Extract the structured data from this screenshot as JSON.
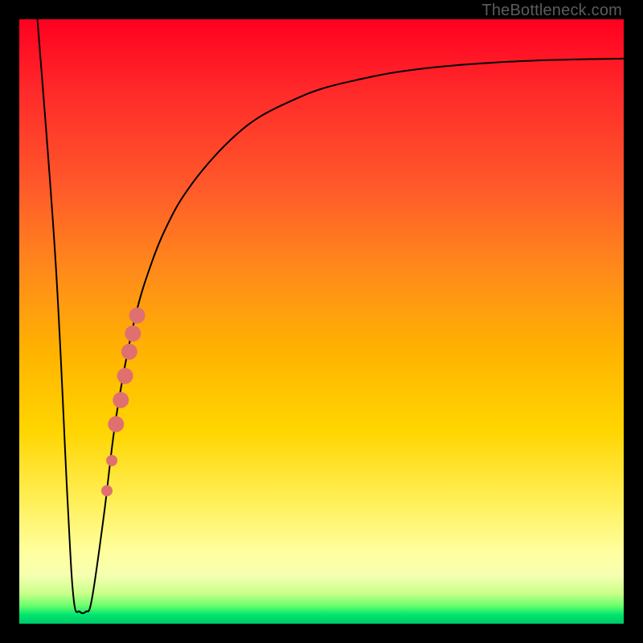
{
  "watermark": "TheBottleneck.com",
  "colors": {
    "frame": "#000000",
    "gradient_top": "#ff0020",
    "gradient_bottom": "#00c96a",
    "curve": "#000000",
    "marker": "#e07070"
  },
  "chart_data": {
    "type": "line",
    "title": "",
    "xlabel": "",
    "ylabel": "",
    "xlim": [
      0,
      100
    ],
    "ylim": [
      0,
      100
    ],
    "grid": false,
    "legend": false,
    "series": [
      {
        "name": "bottleneck-curve",
        "x": [
          3,
          6,
          8,
          9,
          10,
          11,
          12,
          14,
          16,
          19,
          22,
          25,
          28,
          32,
          36,
          40,
          45,
          50,
          56,
          62,
          70,
          78,
          86,
          94,
          100
        ],
        "y": [
          100,
          60,
          20,
          4,
          2,
          2,
          4,
          18,
          34,
          50,
          60,
          67,
          72,
          77,
          81,
          84,
          86.5,
          88.5,
          90,
          91.2,
          92.2,
          92.8,
          93.2,
          93.4,
          93.5
        ]
      }
    ],
    "markers": {
      "name": "highlighted-segment",
      "color": "#e07070",
      "points": [
        {
          "x": 14.5,
          "y": 22
        },
        {
          "x": 15.3,
          "y": 27
        },
        {
          "x": 16.0,
          "y": 33
        },
        {
          "x": 16.8,
          "y": 37
        },
        {
          "x": 17.5,
          "y": 41
        },
        {
          "x": 18.2,
          "y": 45
        },
        {
          "x": 18.8,
          "y": 48
        },
        {
          "x": 19.5,
          "y": 51
        }
      ]
    }
  }
}
